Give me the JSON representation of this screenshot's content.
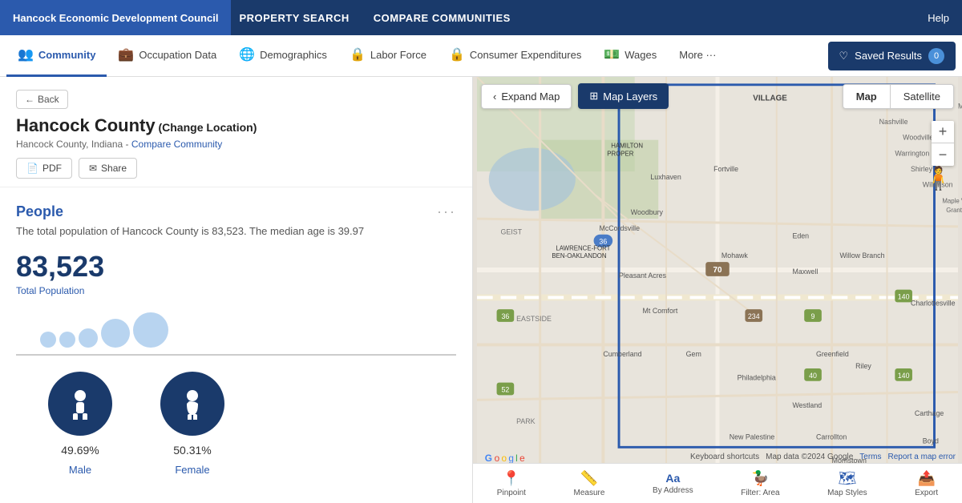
{
  "top_nav": {
    "brand": "Hancock Economic Development Council",
    "links": [
      "PROPERTY SEARCH",
      "COMPARE COMMUNITIES"
    ],
    "help": "Help"
  },
  "second_nav": {
    "tabs": [
      {
        "label": "Community",
        "icon": "👥",
        "active": true
      },
      {
        "label": "Occupation Data",
        "icon": "💼",
        "active": false
      },
      {
        "label": "Demographics",
        "icon": "🌐",
        "active": false
      },
      {
        "label": "Labor Force",
        "icon": "🔒",
        "active": false
      },
      {
        "label": "Consumer Expenditures",
        "icon": "🔒",
        "active": false
      },
      {
        "label": "Wages",
        "icon": "💵",
        "active": false
      },
      {
        "label": "More ···",
        "icon": "",
        "active": false
      }
    ],
    "saved_results": "Saved Results",
    "saved_count": "0"
  },
  "location": {
    "back": "Back",
    "name": "Hancock County",
    "change_location": "(Change Location)",
    "sub": "Hancock County, Indiana",
    "compare": "Compare Community",
    "pdf": "PDF",
    "share": "Share"
  },
  "people": {
    "title": "People",
    "description": "The total population of Hancock County is 83,523. The median age is 39.97",
    "population": "83,523",
    "population_label": "Total Population",
    "male_pct": "49.69",
    "male_label": "Male",
    "female_pct": "50.31",
    "female_label": "Female"
  },
  "map": {
    "expand": "Expand Map",
    "layers": "Map Layers",
    "type_map": "Map",
    "type_satellite": "Satellite",
    "zoom_in": "+",
    "zoom_out": "−",
    "tools": [
      {
        "icon": "📍",
        "label": "Pinpoint"
      },
      {
        "icon": "📏",
        "label": "Measure"
      },
      {
        "icon": "Aa",
        "label": "By Address"
      },
      {
        "icon": "🦆",
        "label": "Filter: Area"
      },
      {
        "icon": "🗺",
        "label": "Map Styles"
      },
      {
        "icon": "📤",
        "label": "Export"
      }
    ],
    "attribution": "Google",
    "credits": [
      "Keyboard shortcuts",
      "Map data ©2024 Google",
      "Terms",
      "Report a map error"
    ]
  }
}
